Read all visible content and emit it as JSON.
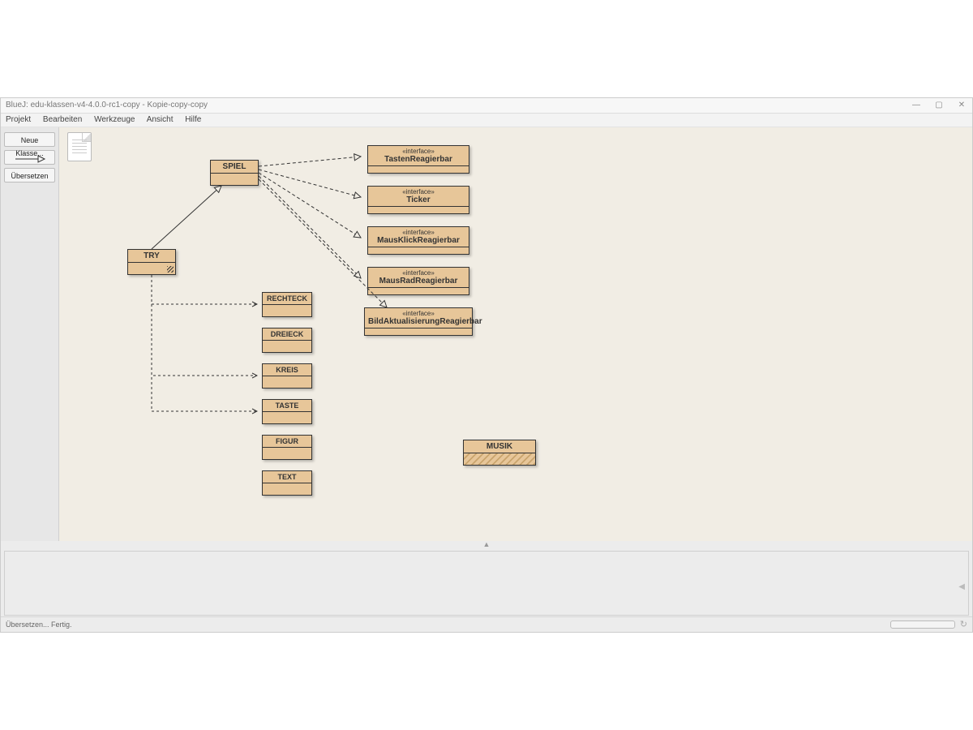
{
  "window": {
    "title": "BlueJ:  edu-klassen-v4-4.0.0-rc1-copy - Kopie-copy-copy",
    "controls": {
      "min": "—",
      "max": "▢",
      "close": "✕"
    }
  },
  "menu": [
    "Projekt",
    "Bearbeiten",
    "Werkzeuge",
    "Ansicht",
    "Hilfe"
  ],
  "sidebar": {
    "newClass": "Neue Klasse...",
    "compile": "Übersetzen"
  },
  "classes": {
    "spiel": "SPIEL",
    "try": "TRY",
    "rechteck": "RECHTECK",
    "dreieck": "DREIECK",
    "kreis": "KREIS",
    "taste": "TASTE",
    "figur": "FIGUR",
    "text": "TEXT",
    "musik": "MUSIK"
  },
  "interfaces": {
    "stereo": "«interface»",
    "tasten": "TastenReagierbar",
    "ticker": "Ticker",
    "mausklick": "MausKlickReagierbar",
    "mausrad": "MausRadReagierbar",
    "bild": "BildAktualisierungReagierbar"
  },
  "status": "Übersetzen... Fertig.",
  "splitter_glyph": "▲"
}
